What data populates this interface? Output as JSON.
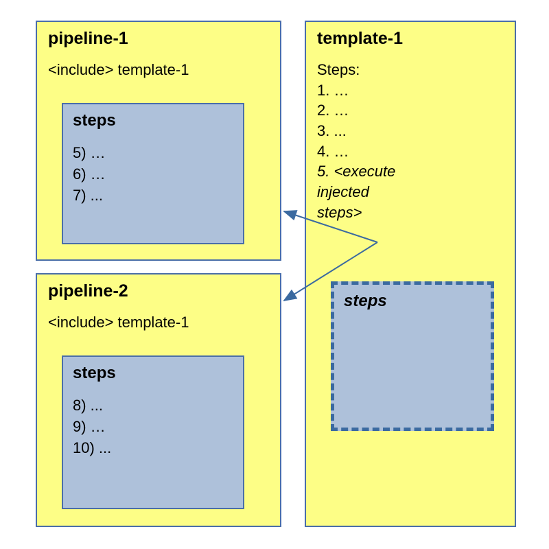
{
  "pipeline1": {
    "title": "pipeline-1",
    "include": "<include> template-1",
    "steps_title": "steps",
    "steps": "5) …\n6) …\n7) ..."
  },
  "pipeline2": {
    "title": "pipeline-2",
    "include": "<include> template-1",
    "steps_title": "steps",
    "steps": "8) ...\n9) …\n10) ..."
  },
  "template1": {
    "title": "template-1",
    "steps_heading": "Steps:",
    "line1": "1. …",
    "line2": "2. …",
    "line3": "3. ...",
    "line4": "4. …",
    "exec": "5. <execute\n    injected\n    steps>",
    "placeholder_title": "steps"
  }
}
